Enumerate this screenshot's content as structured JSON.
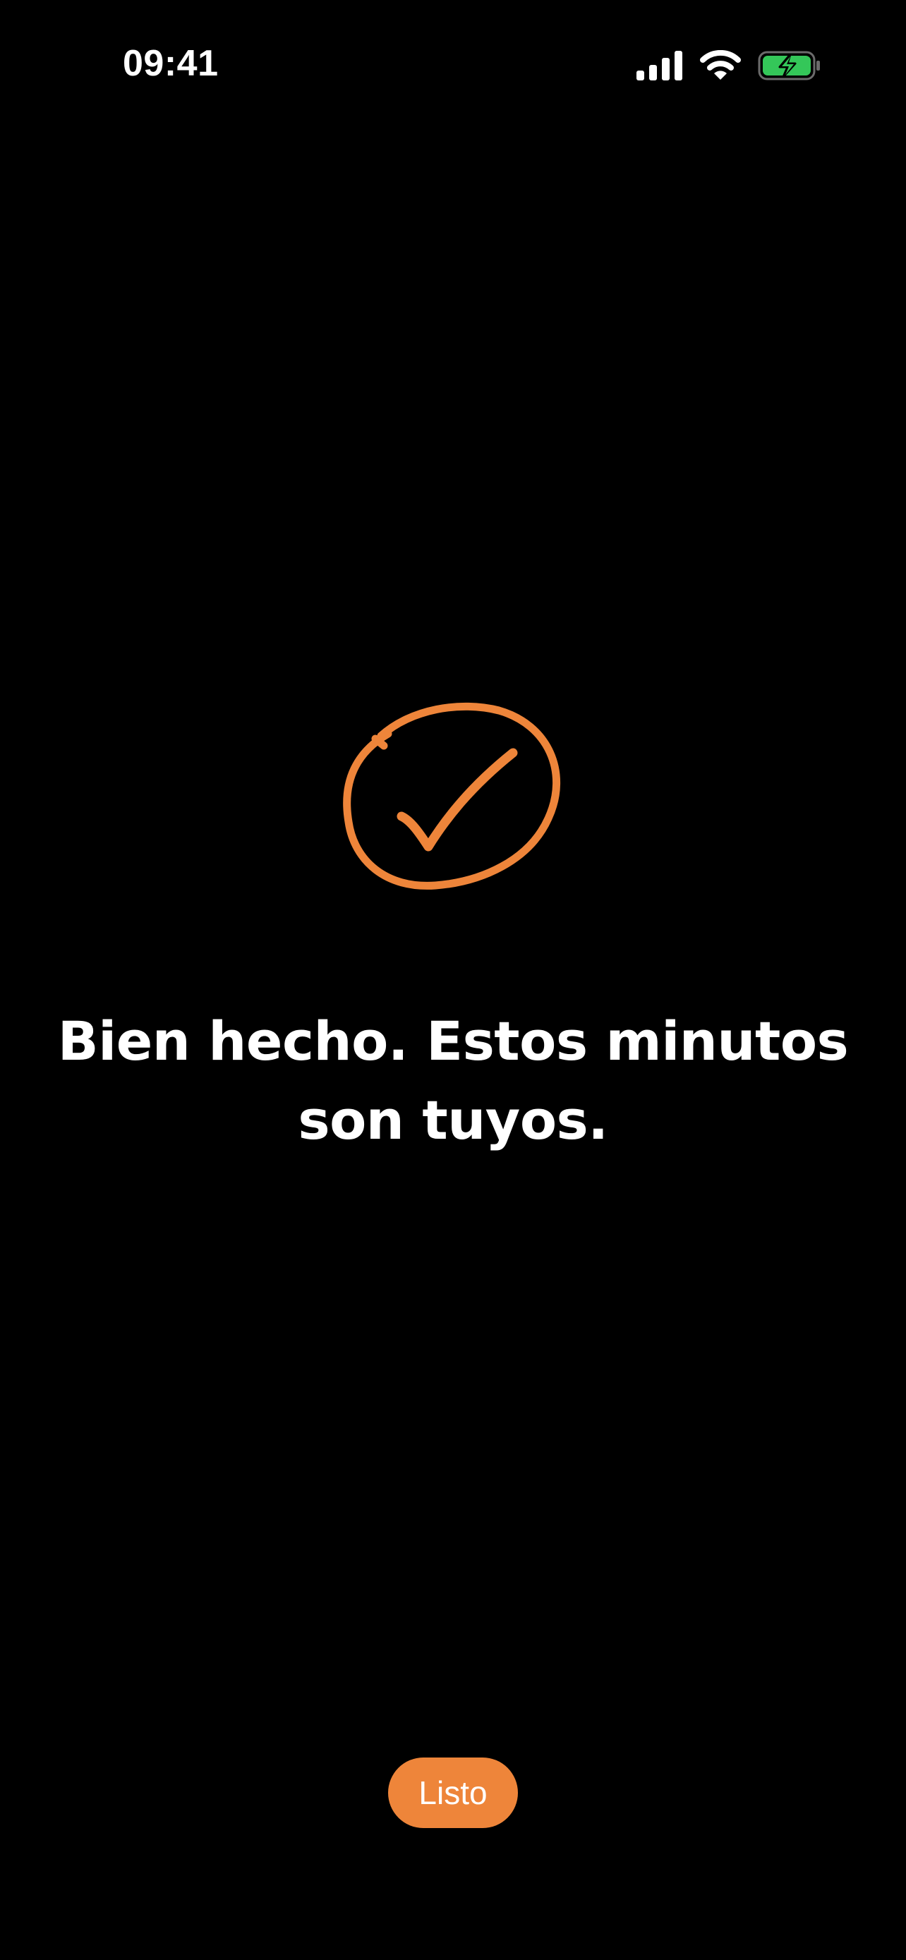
{
  "status_bar": {
    "time": "09:41",
    "icons": [
      "cellular-signal-icon",
      "wifi-icon",
      "battery-charging-icon"
    ]
  },
  "completion": {
    "icon": "hand-drawn-checkmark-icon",
    "message": "Bien hecho. Estos minutos son tuyos."
  },
  "actions": {
    "done_label": "Listo"
  },
  "colors": {
    "background": "#000000",
    "accent": "#EE853A",
    "text": "#FFFFFF",
    "battery_fill": "#34C759"
  }
}
